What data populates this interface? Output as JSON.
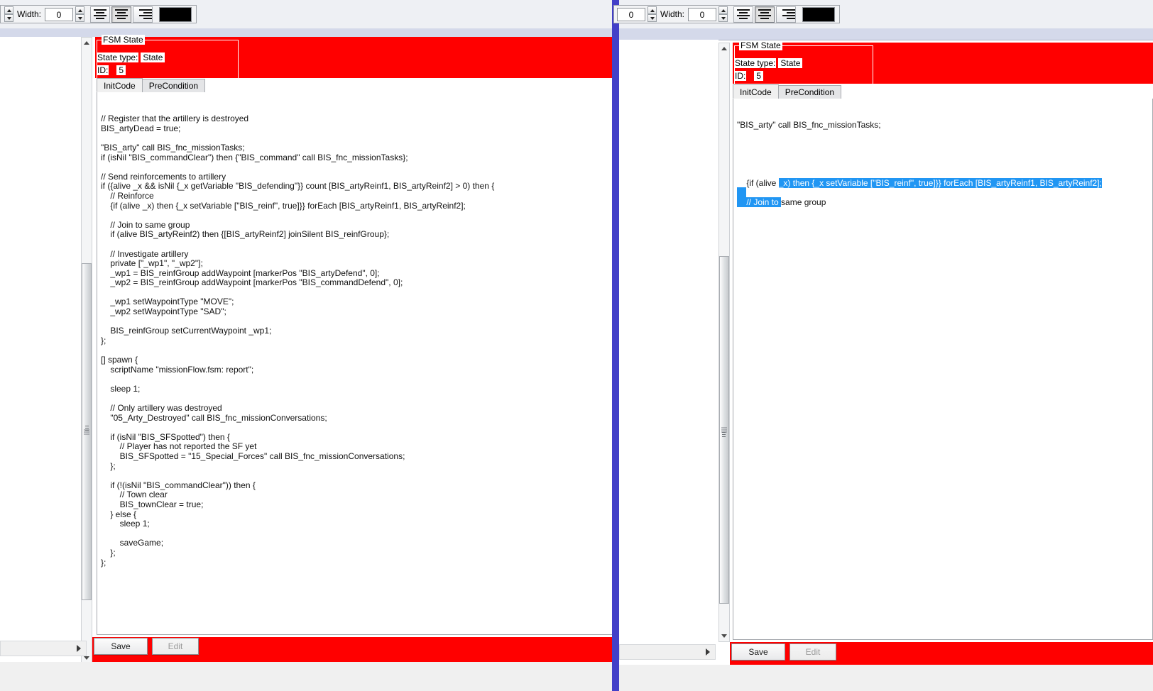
{
  "app": {
    "title": "FSM State Editor"
  },
  "toolbar_left": {
    "width_label": "Width:",
    "width_value": "0",
    "align_left_label": "align-left",
    "align_center_label": "align-center",
    "align_right_label": "align-right",
    "color_value": "#000000",
    "align_active": "center"
  },
  "toolbar_right": {
    "size_value": "0",
    "width_label": "Width:",
    "width_value": "0",
    "align_left_label": "align-left",
    "align_center_label": "align-center",
    "align_right_label": "align-right",
    "color_value": "#000000",
    "align_active": "center"
  },
  "left_panel": {
    "groupbox": {
      "title": "FSM State",
      "state_type_label": "State type:",
      "state_type_value": "State",
      "id_label": "ID:",
      "id_value": "5"
    },
    "tabs": [
      {
        "label": "InitCode",
        "active": true
      },
      {
        "label": "PreCondition",
        "active": false
      }
    ],
    "code_lines": [
      "// Register that the artillery is destroyed",
      "BIS_artyDead = true;",
      "",
      "\"BIS_arty\" call BIS_fnc_missionTasks;",
      "if (isNil \"BIS_commandClear\") then {\"BIS_command\" call BIS_fnc_missionTasks};",
      "",
      "// Send reinforcements to artillery",
      "if ({alive _x && isNil {_x getVariable \"BIS_defending\"}} count [BIS_artyReinf1, BIS_artyReinf2] > 0) then {",
      "    // Reinforce",
      "    {if (alive _x) then {_x setVariable [\"BIS_reinf\", true]}} forEach [BIS_artyReinf1, BIS_artyReinf2];",
      "",
      "    // Join to same group",
      "    if (alive BIS_artyReinf2) then {[BIS_artyReinf2] joinSilent BIS_reinfGroup};",
      "",
      "    // Investigate artillery",
      "    private [\"_wp1\", \"_wp2\"];",
      "    _wp1 = BIS_reinfGroup addWaypoint [markerPos \"BIS_artyDefend\", 0];",
      "    _wp2 = BIS_reinfGroup addWaypoint [markerPos \"BIS_commandDefend\", 0];",
      "",
      "    _wp1 setWaypointType \"MOVE\";",
      "    _wp2 setWaypointType \"SAD\";",
      "",
      "    BIS_reinfGroup setCurrentWaypoint _wp1;",
      "};",
      "",
      "[] spawn {",
      "    scriptName \"missionFlow.fsm: report\";",
      "",
      "    sleep 1;",
      "",
      "    // Only artillery was destroyed",
      "    \"05_Arty_Destroyed\" call BIS_fnc_missionConversations;",
      "",
      "    if (isNil \"BIS_SFSpotted\") then {",
      "        // Player has not reported the SF yet",
      "        BIS_SFSpotted = \"15_Special_Forces\" call BIS_fnc_missionConversations;",
      "    };",
      "",
      "    if (!(isNil \"BIS_commandClear\")) then {",
      "        // Town clear",
      "        BIS_townClear = true;",
      "    } else {",
      "        sleep 1;",
      "",
      "        saveGame;",
      "    };",
      "};"
    ],
    "save_label": "Save",
    "edit_label": "Edit",
    "edit_disabled": true
  },
  "right_panel": {
    "groupbox": {
      "title": "FSM State",
      "state_type_label": "State type:",
      "state_type_value": "State",
      "id_label": "ID:",
      "id_value": "5"
    },
    "tabs": [
      {
        "label": "InitCode",
        "active": true
      },
      {
        "label": "PreCondition",
        "active": false
      }
    ],
    "code_segments": [
      {
        "text": "\"BIS_arty\" call BIS_fnc_missionTasks;",
        "selected": false
      },
      {
        "text": "",
        "selected": false
      },
      {
        "text": "",
        "selected": false
      },
      {
        "text": "",
        "selected": false
      },
      {
        "text": "",
        "selected": false
      },
      {
        "text": "",
        "selected": false
      },
      {
        "text": "    {if (alive ",
        "selected": false
      },
      {
        "text": "_x) then {_x setVariable [\"BIS_reinf\", true]}} forEach [BIS_artyReinf1, BIS_artyReinf2];",
        "selected": true
      },
      {
        "text": "    ",
        "selected": true
      },
      {
        "text": "    // Join to ",
        "selected": true
      },
      {
        "text": "same group",
        "selected": false
      }
    ],
    "selection_line_1_prefix": "    {if (alive ",
    "selection_line_1_selected": "_x) then {_x setVariable [\"BIS_reinf\", true]}} forEach [BIS_artyReinf1, BIS_artyReinf2];",
    "selection_line_2_selected": "    ",
    "selection_line_3_selected": "    // Join to ",
    "selection_line_3_rest": "same group",
    "code_line_1": "\"BIS_arty\" call BIS_fnc_missionTasks;",
    "save_label": "Save",
    "edit_label": "Edit",
    "edit_disabled": true
  },
  "colors": {
    "red_background": "#ff0000",
    "selection_blue": "#2196f3",
    "divider_blue": "#4340c8",
    "title_strip": "#d4d9ea"
  }
}
